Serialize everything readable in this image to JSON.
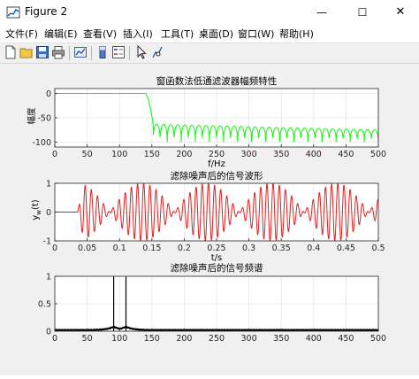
{
  "window": {
    "title": "Figure 2",
    "controls": {
      "minimize": "—",
      "maximize": "☐",
      "close": "✕"
    }
  },
  "menu": [
    {
      "label": "文件(F)"
    },
    {
      "label": "编辑(E)"
    },
    {
      "label": "查看(V)"
    },
    {
      "label": "插入(I)"
    },
    {
      "label": "工具(T)"
    },
    {
      "label": "桌面(D)"
    },
    {
      "label": "窗口(W)"
    },
    {
      "label": "帮助(H)"
    }
  ],
  "toolbar": [
    {
      "icon": "new-figure-icon"
    },
    {
      "icon": "open-file-icon"
    },
    {
      "icon": "save-icon"
    },
    {
      "icon": "print-icon"
    },
    {
      "icon": "link-plot-icon"
    },
    {
      "icon": "insert-colorbar-icon"
    },
    {
      "icon": "insert-legend-icon"
    },
    {
      "icon": "edit-plot-arrow-icon"
    },
    {
      "icon": "data-cursor-icon"
    }
  ],
  "colors": {
    "line_green": "#00ff00",
    "line_red": "#e02020",
    "line_black": "#000000",
    "axes_bg": "#ffffff",
    "figure_bg": "#f0f0f0",
    "grid": "#e6e6e6"
  },
  "chart_data": [
    {
      "type": "line",
      "title": "窗函数法低通滤波器幅频特性",
      "xlabel": "f/Hz",
      "ylabel": "幅度",
      "xlim": [
        0,
        500
      ],
      "ylim": [
        -110,
        10
      ],
      "xticks": [
        0,
        50,
        100,
        150,
        200,
        250,
        300,
        350,
        400,
        450,
        500
      ],
      "yticks": [
        0,
        -50,
        -100
      ],
      "grid": true,
      "series": [
        {
          "color": "#00ff00",
          "description_points": {
            "passband_end_hz": 140,
            "passband_db": 0,
            "transition_end_hz": 152,
            "sidelobe_top_start_db": -63,
            "sidelobe_top_end_db": -75,
            "sidelobe_bottom_db": -100,
            "sidelobe_count": 32
          }
        }
      ]
    },
    {
      "type": "line",
      "title": "滤除噪声后的信号波形",
      "xlabel": "t/s",
      "ylabel": "y_w(t)",
      "xlim": [
        0,
        0.5
      ],
      "ylim": [
        -1,
        1
      ],
      "xticks": [
        0,
        0.05,
        0.1,
        0.15,
        0.2,
        0.25,
        0.3,
        0.35,
        0.4,
        0.45,
        0.5
      ],
      "yticks": [
        1,
        0,
        -1
      ],
      "grid": true,
      "series": [
        {
          "color": "#e02020",
          "delay_s": 0.035,
          "components_hz": [
            100,
            110
          ],
          "amplitude": 1
        }
      ]
    },
    {
      "type": "line",
      "title": "滤除噪声后的信号频谱",
      "xlabel": "",
      "ylabel": "",
      "xlim": [
        0,
        500
      ],
      "ylim": [
        0,
        1
      ],
      "xticks": [
        0,
        50,
        100,
        150,
        200,
        250,
        300,
        350,
        400,
        450,
        500
      ],
      "yticks": [
        1,
        0.5,
        0
      ],
      "grid": true,
      "series": [
        {
          "color": "#000000",
          "peaks": [
            {
              "x": 91,
              "y": 1.0
            },
            {
              "x": 110,
              "y": 1.0
            }
          ]
        }
      ]
    }
  ]
}
